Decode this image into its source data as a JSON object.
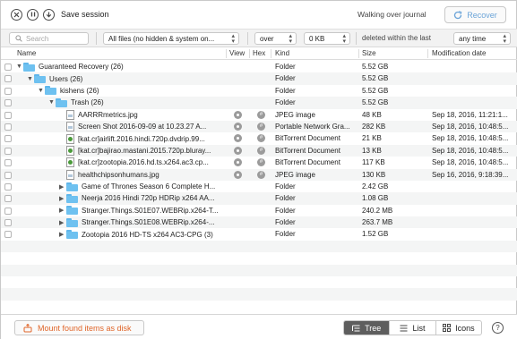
{
  "toolbar": {
    "save_label": "Save session",
    "status": "Walking over journal",
    "recover_label": "Recover"
  },
  "filters": {
    "search_placeholder": "Search",
    "file_filter": "All files (no hidden & system on...",
    "size_op": "over",
    "size_value": "0 KB",
    "date_label": "deleted within the last",
    "date_value": "any time"
  },
  "columns": {
    "name": "Name",
    "view": "View",
    "hex": "Hex",
    "kind": "Kind",
    "size": "Size",
    "modified": "Modification date"
  },
  "rows": [
    {
      "name": "Guaranteed Recovery (26)",
      "kind": "Folder",
      "size": "5.52 GB",
      "modified": "",
      "depth": 0,
      "type": "folder",
      "open": true,
      "actions": false
    },
    {
      "name": "Users (26)",
      "kind": "Folder",
      "size": "5.52 GB",
      "modified": "",
      "depth": 1,
      "type": "folder",
      "open": true,
      "actions": false
    },
    {
      "name": "kishens (26)",
      "kind": "Folder",
      "size": "5.52 GB",
      "modified": "",
      "depth": 2,
      "type": "folder",
      "open": true,
      "actions": false
    },
    {
      "name": "Trash (26)",
      "kind": "Folder",
      "size": "5.52 GB",
      "modified": "",
      "depth": 3,
      "type": "folder",
      "open": true,
      "actions": false
    },
    {
      "name": "AARRRmetrics.jpg",
      "kind": "JPEG image",
      "size": "48 KB",
      "modified": "Sep 18, 2016, 11:21:1...",
      "depth": 4,
      "type": "image",
      "open": false,
      "actions": true
    },
    {
      "name": "Screen Shot 2016-09-09 at 10.23.27 A...",
      "kind": "Portable Network Gra...",
      "size": "282 KB",
      "modified": "Sep 18, 2016, 10:48:5...",
      "depth": 4,
      "type": "image",
      "open": false,
      "actions": true
    },
    {
      "name": "[kat.cr]airlift.2016.hindi.720p.dvdrip.99...",
      "kind": "BitTorrent Document",
      "size": "21 KB",
      "modified": "Sep 18, 2016, 10:48:5...",
      "depth": 4,
      "type": "torrent",
      "open": false,
      "actions": true
    },
    {
      "name": "[kat.cr]bajirao.mastani.2015.720p.bluray...",
      "kind": "BitTorrent Document",
      "size": "13 KB",
      "modified": "Sep 18, 2016, 10:48:5...",
      "depth": 4,
      "type": "torrent",
      "open": false,
      "actions": true
    },
    {
      "name": "[kat.cr]zootopia.2016.hd.ts.x264.ac3.cp...",
      "kind": "BitTorrent Document",
      "size": "117 KB",
      "modified": "Sep 18, 2016, 10:48:5...",
      "depth": 4,
      "type": "torrent",
      "open": false,
      "actions": true
    },
    {
      "name": "healthchipsonhumans.jpg",
      "kind": "JPEG image",
      "size": "130 KB",
      "modified": "Sep 16, 2016, 9:18:39...",
      "depth": 4,
      "type": "image",
      "open": false,
      "actions": true
    },
    {
      "name": "Game of Thrones Season 6 Complete H...",
      "kind": "Folder",
      "size": "2.42 GB",
      "modified": "",
      "depth": 4,
      "type": "folder",
      "open": false,
      "actions": false
    },
    {
      "name": "Neerja 2016 Hindi 720p HDRip x264 AA...",
      "kind": "Folder",
      "size": "1.08 GB",
      "modified": "",
      "depth": 4,
      "type": "folder",
      "open": false,
      "actions": false
    },
    {
      "name": "Stranger.Things.S01E07.WEBRip.x264-T...",
      "kind": "Folder",
      "size": "240.2 MB",
      "modified": "",
      "depth": 4,
      "type": "folder",
      "open": false,
      "actions": false
    },
    {
      "name": "Stranger.Things.S01E08.WEBRip.x264-...",
      "kind": "Folder",
      "size": "263.7 MB",
      "modified": "",
      "depth": 4,
      "type": "folder",
      "open": false,
      "actions": false
    },
    {
      "name": "Zootopia 2016 HD-TS x264 AC3-CPG (3)",
      "kind": "Folder",
      "size": "1.52 GB",
      "modified": "",
      "depth": 4,
      "type": "folder",
      "open": false,
      "actions": false
    }
  ],
  "bottom": {
    "mount_label": "Mount found items as disk",
    "view_tree": "Tree",
    "view_list": "List",
    "view_icons": "Icons",
    "help": "?"
  }
}
